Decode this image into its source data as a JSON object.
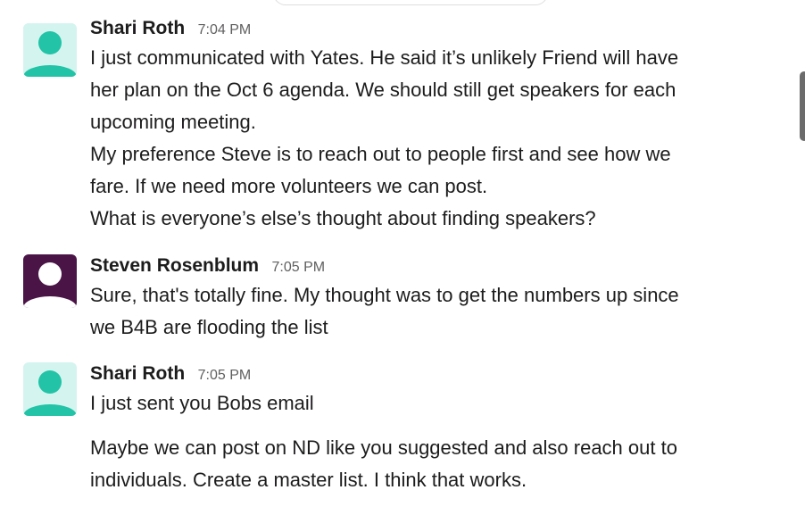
{
  "messages": [
    {
      "sender": "Shari Roth",
      "time": "7:04 PM",
      "avatar_color": "#22c3a6",
      "lines": [
        "I just communicated with Yates.  He said it’s unlikely Friend will have",
        "her plan on the Oct 6 agenda. We should still get speakers for each",
        "upcoming meeting.",
        "My preference Steve is to reach out to people first and see how we",
        "fare.  If we need more volunteers we can post.",
        "What is everyone’s else’s thought about finding speakers?"
      ]
    },
    {
      "sender": "Steven Rosenblum",
      "time": "7:05 PM",
      "avatar_color": "#4a1546",
      "lines": [
        "Sure, that's totally fine.    My thought was to get the numbers up since",
        "we B4B are flooding the list"
      ]
    },
    {
      "sender": "Shari Roth",
      "time": "7:05 PM",
      "avatar_color": "#22c3a6",
      "lines": [
        "I just sent you Bobs email"
      ],
      "followup_lines": [
        "Maybe we can post on ND like you suggested and also reach out to",
        "individuals.  Create a master list.  I think that works."
      ]
    }
  ]
}
